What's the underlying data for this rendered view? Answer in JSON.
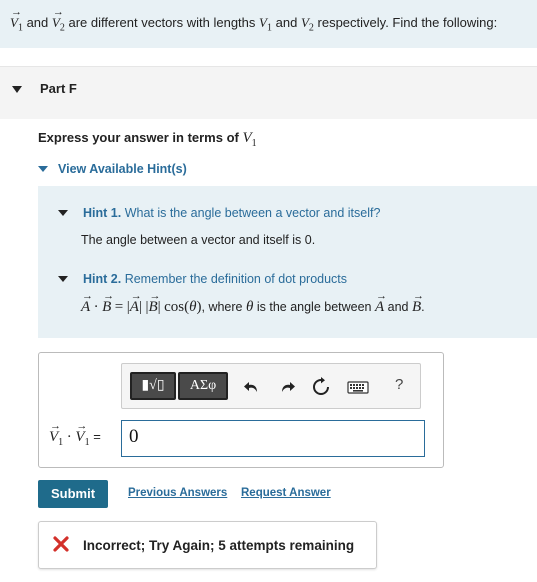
{
  "problem": {
    "v1": "V",
    "v1_sub": "1",
    "and1": "and",
    "v2": "V",
    "v2_sub": "2",
    "mid": "are different vectors with lengths",
    "l1": "V",
    "l1_sub": "1",
    "and2": "and",
    "l2": "V",
    "l2_sub": "2",
    "end": "respectively. Find the following:"
  },
  "part": {
    "title": "Part F"
  },
  "instruction": {
    "text": "Express your answer in terms of",
    "var": "V",
    "var_sub": "1"
  },
  "hints_toggle": {
    "label": "View Available Hint(s)"
  },
  "hints": [
    {
      "number": "Hint 1.",
      "title": "What is the angle between a vector and itself?",
      "body": "The angle between a vector and itself is 0."
    },
    {
      "number": "Hint 2.",
      "title": "Remember the definition of dot products",
      "formula": {
        "a": "A",
        "dot": "·",
        "b": "B",
        "eq": "=",
        "abs_a": "A",
        "abs_b": "B",
        "cos": "cos",
        "theta": "θ",
        "where": ", where",
        "theta2": "θ",
        "desc": "is the angle between",
        "a2": "A",
        "and": "and",
        "b2": "B",
        "period": "."
      }
    }
  ],
  "toolbar": {
    "template_label": "▮√▯",
    "symbols_label": "ΑΣφ",
    "help_label": "?",
    "icons": [
      "template-icon",
      "greek-symbols-icon",
      "undo-icon",
      "redo-icon",
      "reset-icon",
      "keyboard-icon",
      "help-icon"
    ]
  },
  "answer": {
    "label_v": "V",
    "label_sub": "1",
    "label_dot": "·",
    "label_v2": "V",
    "label_sub2": "1",
    "label_eq": "=",
    "value": "0"
  },
  "actions": {
    "submit": "Submit",
    "previous_answers": "Previous Answers",
    "request_answer": "Request Answer"
  },
  "feedback": {
    "message": "Incorrect; Try Again; 5 attempts remaining",
    "color": "#d3302a"
  },
  "colors": {
    "accent": "#2a6c9a",
    "button": "#1f6b8b",
    "panel": "#e8f1f5"
  }
}
